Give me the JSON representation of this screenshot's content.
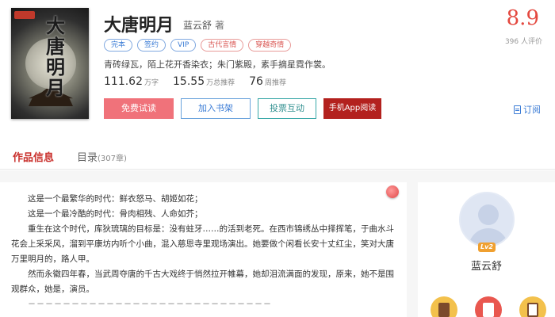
{
  "book": {
    "title": "大唐明月",
    "author": "蓝云舒",
    "author_suffix": "著",
    "cover_text": "大唐明月",
    "tags": [
      {
        "label": "完本",
        "color": "blue"
      },
      {
        "label": "签约",
        "color": "blue"
      },
      {
        "label": "VIP",
        "color": "blue"
      },
      {
        "label": "古代言情",
        "color": "red"
      },
      {
        "label": "穿越奇情",
        "color": "red"
      }
    ],
    "intro": "青砖绿瓦，陌上花开香染衣；朱门紫殿，素手摘星霓作裳。",
    "stats": {
      "words": "111.62",
      "words_unit": "万字",
      "recommend": "15.55",
      "recommend_unit": "万总推荐",
      "weekly": "76",
      "weekly_unit": "周推荐"
    },
    "score": "8.9",
    "rating_count": "396 人评价"
  },
  "actions": {
    "trial": "免费试读",
    "shelf": "加入书架",
    "vote": "投票互动",
    "app": "手机App阅读",
    "subscribe": "订阅"
  },
  "tabs": {
    "info": "作品信息",
    "toc": "目录",
    "toc_count": "(307章)"
  },
  "description": [
    "这是一个最繁华的时代：鲜衣怒马、胡姬如花；",
    "这是一个最冷酷的时代：骨肉相残、人命如芥；",
    "重生在这个时代，库狄琉璃的目标是：没有蛀牙……的活到老死。在西市锦绣丛中择挥笔，于曲水斗花会上采采风，溜到平康坊内听个小曲，混入慈恩寺里观场演出。她要做个闲看长安十丈红尘，笑对大唐万里明月的，路人甲。",
    "然而永徽四年春，当武周夺唐的千古大戏终于悄然拉开帷幕，她却泪流满面的发现，原来，她不是围观群众，她是，演员。"
  ],
  "dashes": "－－－－－－－－－－－－－－－－－－－－－－－－－－－－",
  "author_panel": {
    "level": "Lv2",
    "name": "蓝云舒"
  }
}
